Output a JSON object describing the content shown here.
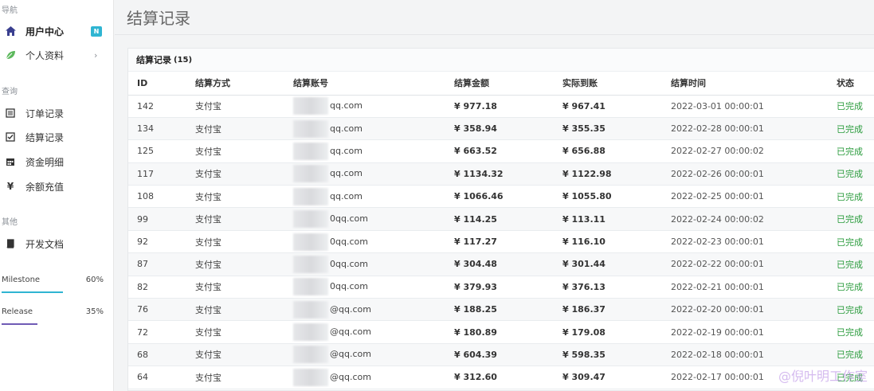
{
  "sidebar": {
    "section_nav": "导航",
    "section_query": "查询",
    "section_other": "其他",
    "items": [
      {
        "label": "用户中心",
        "icon": "home-icon",
        "badge": "N",
        "active": true
      },
      {
        "label": "个人资料",
        "icon": "leaf-icon",
        "chevron": "›"
      },
      {
        "label": "订单记录",
        "icon": "list-icon"
      },
      {
        "label": "结算记录",
        "icon": "check-square-icon"
      },
      {
        "label": "资金明细",
        "icon": "calendar-icon"
      },
      {
        "label": "余额充值",
        "icon": "yen-icon"
      },
      {
        "label": "开发文档",
        "icon": "book-icon"
      }
    ],
    "progress": [
      {
        "label": "Milestone",
        "pct_text": "60%",
        "value": 0.6,
        "color": "#2fb5d2"
      },
      {
        "label": "Release",
        "pct_text": "35%",
        "value": 0.35,
        "color": "#6f5bb5"
      }
    ]
  },
  "page": {
    "title": "结算记录"
  },
  "card": {
    "title": "结算记录",
    "count": "(15)",
    "columns": [
      "ID",
      "结算方式",
      "结算账号",
      "结算金额",
      "实际到账",
      "结算时间",
      "状态"
    ],
    "rows": [
      {
        "id": "142",
        "method": "支付宝",
        "account": "qq.com",
        "amount": "¥ 977.18",
        "actual": "¥ 967.41",
        "time": "2022-03-01 00:00:01",
        "status": "已完成"
      },
      {
        "id": "134",
        "method": "支付宝",
        "account": "qq.com",
        "amount": "¥ 358.94",
        "actual": "¥ 355.35",
        "time": "2022-02-28 00:00:01",
        "status": "已完成"
      },
      {
        "id": "125",
        "method": "支付宝",
        "account": "qq.com",
        "amount": "¥ 663.52",
        "actual": "¥ 656.88",
        "time": "2022-02-27 00:00:02",
        "status": "已完成"
      },
      {
        "id": "117",
        "method": "支付宝",
        "account": "qq.com",
        "amount": "¥ 1134.32",
        "actual": "¥ 1122.98",
        "time": "2022-02-26 00:00:01",
        "status": "已完成"
      },
      {
        "id": "108",
        "method": "支付宝",
        "account": "qq.com",
        "amount": "¥ 1066.46",
        "actual": "¥ 1055.80",
        "time": "2022-02-25 00:00:01",
        "status": "已完成"
      },
      {
        "id": "99",
        "method": "支付宝",
        "account": "0qq.com",
        "amount": "¥ 114.25",
        "actual": "¥ 113.11",
        "time": "2022-02-24 00:00:02",
        "status": "已完成"
      },
      {
        "id": "92",
        "method": "支付宝",
        "account": "0qq.com",
        "amount": "¥ 117.27",
        "actual": "¥ 116.10",
        "time": "2022-02-23 00:00:01",
        "status": "已完成"
      },
      {
        "id": "87",
        "method": "支付宝",
        "account": "0qq.com",
        "amount": "¥ 304.48",
        "actual": "¥ 301.44",
        "time": "2022-02-22 00:00:01",
        "status": "已完成"
      },
      {
        "id": "82",
        "method": "支付宝",
        "account": "0qq.com",
        "amount": "¥ 379.93",
        "actual": "¥ 376.13",
        "time": "2022-02-21 00:00:01",
        "status": "已完成"
      },
      {
        "id": "76",
        "method": "支付宝",
        "account": "@qq.com",
        "amount": "¥ 188.25",
        "actual": "¥ 186.37",
        "time": "2022-02-20 00:00:01",
        "status": "已完成"
      },
      {
        "id": "72",
        "method": "支付宝",
        "account": "@qq.com",
        "amount": "¥ 180.89",
        "actual": "¥ 179.08",
        "time": "2022-02-19 00:00:01",
        "status": "已完成"
      },
      {
        "id": "68",
        "method": "支付宝",
        "account": "@qq.com",
        "amount": "¥ 604.39",
        "actual": "¥ 598.35",
        "time": "2022-02-18 00:00:01",
        "status": "已完成"
      },
      {
        "id": "64",
        "method": "支付宝",
        "account": "@qq.com",
        "amount": "¥ 312.60",
        "actual": "¥ 309.47",
        "time": "2022-02-17 00:00:01",
        "status": "已完成"
      }
    ]
  },
  "watermark": "@倪叶明工作室"
}
